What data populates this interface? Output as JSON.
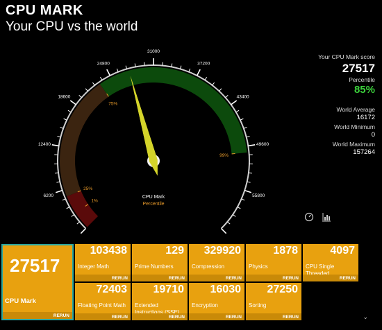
{
  "header": {
    "title": "CPU MARK",
    "subtitle": "Your CPU vs the world"
  },
  "gauge": {
    "min": 0,
    "max": 62000,
    "ticks": [
      "0",
      "6200",
      "12400",
      "18600",
      "24800",
      "31000",
      "37200",
      "43400",
      "49600",
      "55800",
      "62000"
    ],
    "needle_value": 27517,
    "percentile_marks": [
      "1%",
      "25%",
      "75%",
      "99%"
    ],
    "legend_mark": "CPU Mark",
    "legend_pct": "Percentile",
    "colors": {
      "red": "#5a0a0a",
      "brown": "#3b2410",
      "green": "#0c4a0c",
      "needle": "#d4d42a",
      "mark_pct": "#e89a2a",
      "tick": "#ffffff"
    }
  },
  "stats": {
    "score_label": "Your CPU Mark score",
    "score": "27517",
    "percentile_label": "Percentile",
    "percentile": "85%",
    "avg_label": "World Average",
    "avg": "16172",
    "min_label": "World Minimum",
    "min": "0",
    "max_label": "World Maximum",
    "max": "157264"
  },
  "icons": [
    "gauge-icon",
    "chart-icon"
  ],
  "main_tile": {
    "value": "27517",
    "name": "CPU Mark",
    "rerun": "RERUN"
  },
  "tiles": [
    {
      "value": "103438",
      "name": "Integer Math",
      "rerun": "RERUN"
    },
    {
      "value": "129",
      "name": "Prime Numbers",
      "rerun": "RERUN"
    },
    {
      "value": "329920",
      "name": "Compression",
      "rerun": "RERUN"
    },
    {
      "value": "1878",
      "name": "Physics",
      "rerun": "RERUN"
    },
    {
      "value": "4097",
      "name": "CPU Single Threaded",
      "rerun": "RERUN"
    },
    {
      "value": "72403",
      "name": "Floating Point Math",
      "rerun": "RERUN"
    },
    {
      "value": "19710",
      "name": "Extended Instructions (SSE)",
      "rerun": "RERUN"
    },
    {
      "value": "16030",
      "name": "Encryption",
      "rerun": "RERUN"
    },
    {
      "value": "27250",
      "name": "Sorting",
      "rerun": "RERUN"
    }
  ],
  "scroll_icon": "chevron-down-icon"
}
